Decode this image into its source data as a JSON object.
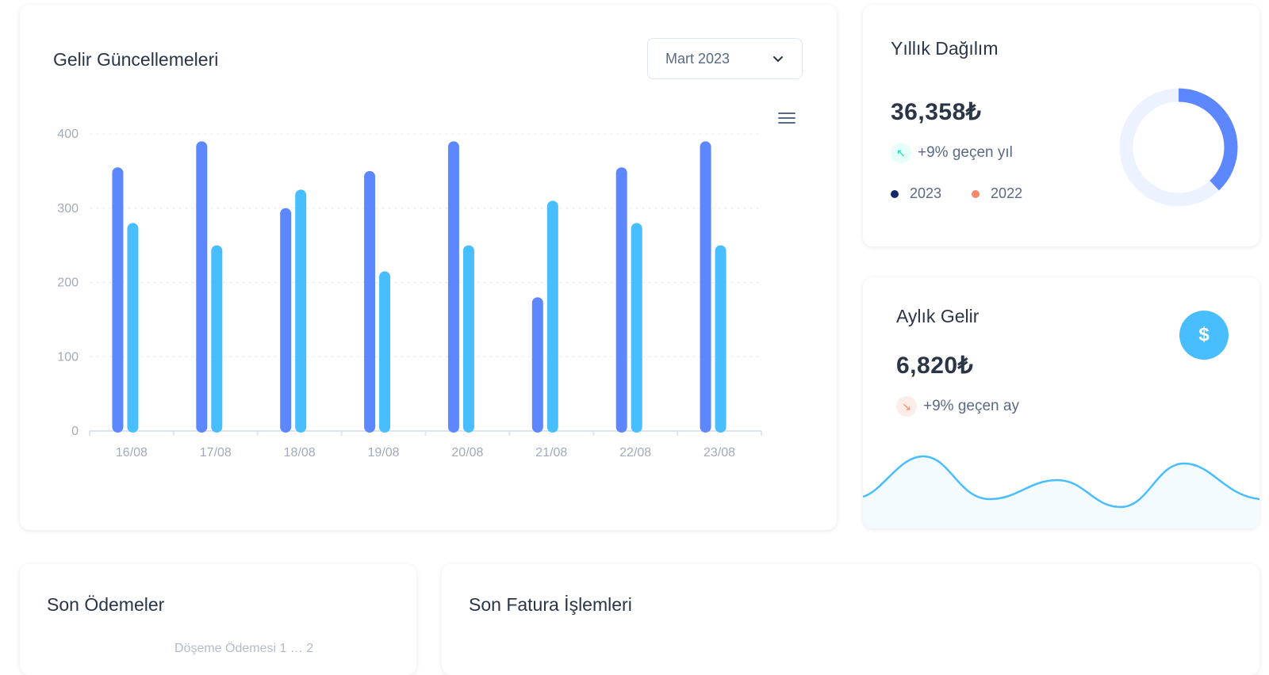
{
  "revenue": {
    "title": "Gelir Güncellemeleri",
    "select_value": "Mart 2023"
  },
  "chart_data": {
    "type": "bar",
    "categories": [
      "16/08",
      "17/08",
      "18/08",
      "19/08",
      "20/08",
      "21/08",
      "22/08",
      "23/08"
    ],
    "series": [
      {
        "values": [
          355,
          390,
          300,
          350,
          390,
          180,
          355,
          390
        ],
        "color": "#5d87ff"
      },
      {
        "values": [
          280,
          250,
          325,
          215,
          250,
          310,
          280,
          250
        ],
        "color": "#49beff"
      }
    ],
    "ylim": [
      0,
      400
    ],
    "yticks": [
      "0",
      "100",
      "200",
      "300",
      "400"
    ],
    "grid": true
  },
  "yearly": {
    "title": "Yıllık Dağılım",
    "value": "36,358₺",
    "change": "+9% geçen yıl",
    "legend": [
      {
        "label": "2023",
        "color": "#13296b"
      },
      {
        "label": "2022",
        "color": "#fa896b"
      }
    ],
    "donut": {
      "filled_fraction": 0.38,
      "filled_color": "#5d87ff",
      "track_color": "#ecf2ff"
    }
  },
  "monthly": {
    "title": "Aylık Gelir",
    "value": "6,820₺",
    "change": "+9% geçen ay",
    "wave_color": "#49beff"
  },
  "payments": {
    "title": "Son Ödemeler",
    "partial_text": "Döşeme Ödemesi 1 … 2"
  },
  "invoice": {
    "title": "Son Fatura İşlemleri"
  },
  "icons": {
    "select": "chevron-down-icon",
    "menu": "hamburger-menu-icon",
    "yearly_change": "arrow-up-left-icon",
    "monthly_change": "arrow-down-right-icon",
    "monthly_badge": "dollar-icon"
  }
}
